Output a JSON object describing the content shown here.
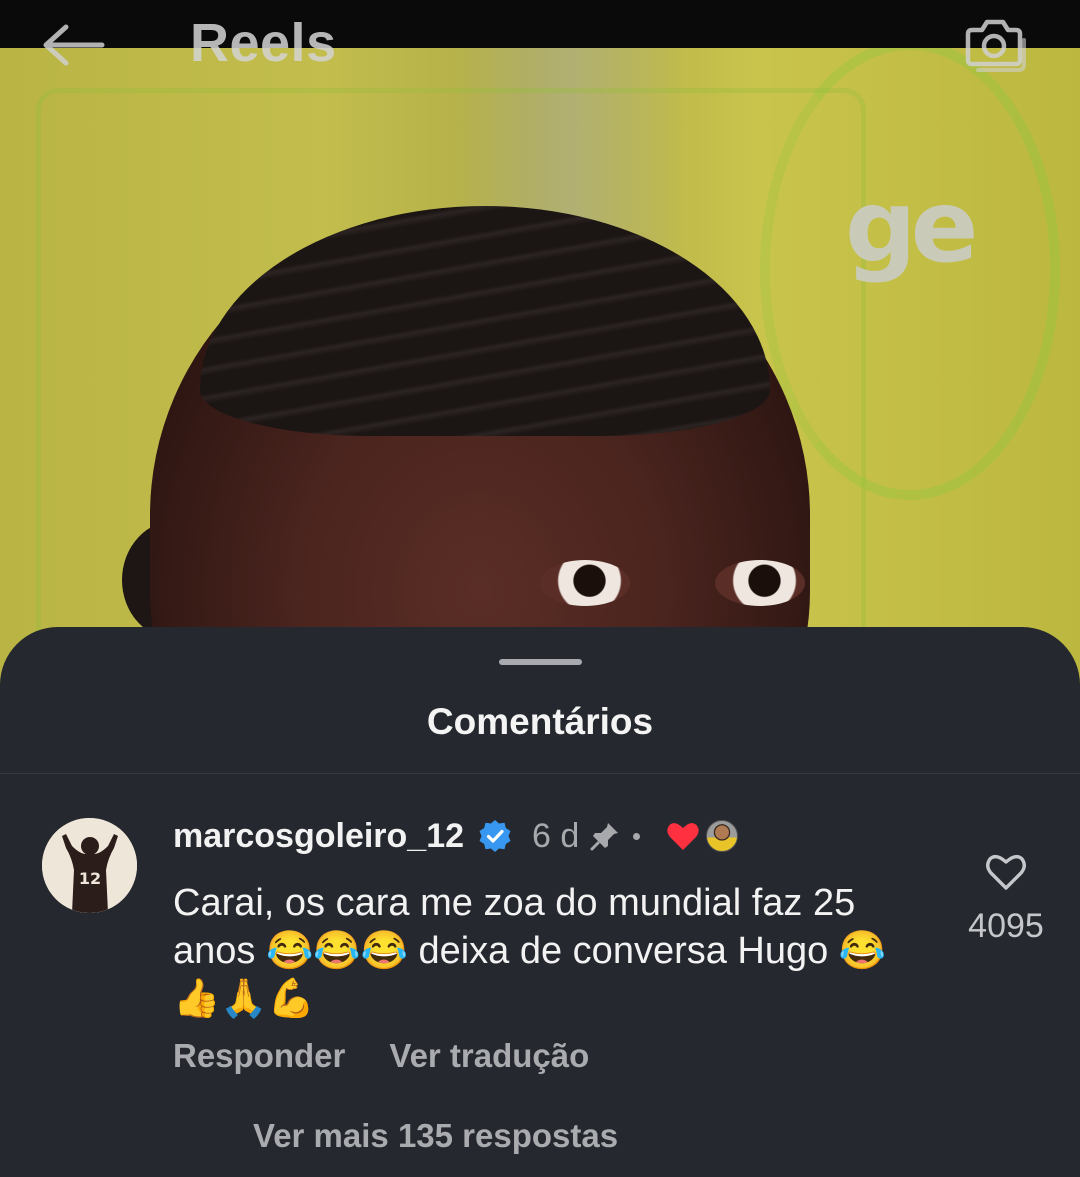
{
  "topbar": {
    "title": "Reels",
    "back_icon": "arrow-left-icon",
    "camera_icon": "camera-icon"
  },
  "video": {
    "logo_text": "ge",
    "accent_color": "#c2bd4c"
  },
  "comments_sheet": {
    "title": "Comentários",
    "comment": {
      "username": "marcosgoleiro_12",
      "verified": true,
      "timestamp": "6 d",
      "pinned": true,
      "liked_by_creator": true,
      "text": "Carai, os cara me zoa do mundial faz 25 anos 😂😂😂 deixa de conversa Hugo 😂 👍🙏💪",
      "like_count": "4095",
      "avatar_jersey_number": "12",
      "actions": {
        "reply": "Responder",
        "translate": "Ver tradução"
      },
      "more_replies": "Ver mais 135 respostas"
    }
  },
  "colors": {
    "sheet_bg": "#25282e",
    "verified_blue": "#3897f0",
    "heart_red": "#ff3040",
    "muted_text": "#a9abaf"
  }
}
